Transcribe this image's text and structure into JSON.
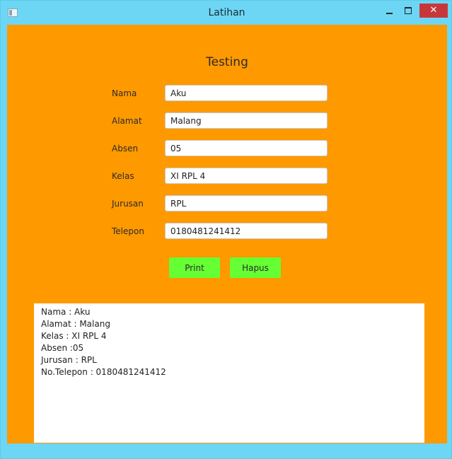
{
  "window": {
    "title": "Latihan",
    "close_symbol": "✕",
    "icons": {
      "app": "app-window-icon",
      "minimize": "minimize-icon",
      "maximize": "maximize-icon",
      "close": "close-icon"
    }
  },
  "colors": {
    "titlebar": "#6dd6f5",
    "content_bg": "#ff9900",
    "button_bg": "#66ff33",
    "close_bg": "#c7373a"
  },
  "form": {
    "heading": "Testing",
    "fields": [
      {
        "label": "Nama",
        "value": "Aku"
      },
      {
        "label": "Alamat",
        "value": "Malang"
      },
      {
        "label": "Absen",
        "value": "05"
      },
      {
        "label": "Kelas",
        "value": "XI RPL 4"
      },
      {
        "label": "Jurusan",
        "value": "RPL"
      },
      {
        "label": "Telepon",
        "value": "0180481241412"
      }
    ],
    "print_label": "Print",
    "hapus_label": "Hapus"
  },
  "output": {
    "lines": [
      "Nama : Aku",
      "Alamat : Malang",
      "Kelas : XI RPL 4",
      "Absen :05",
      "Jurusan : RPL",
      "No.Telepon : 0180481241412"
    ]
  }
}
